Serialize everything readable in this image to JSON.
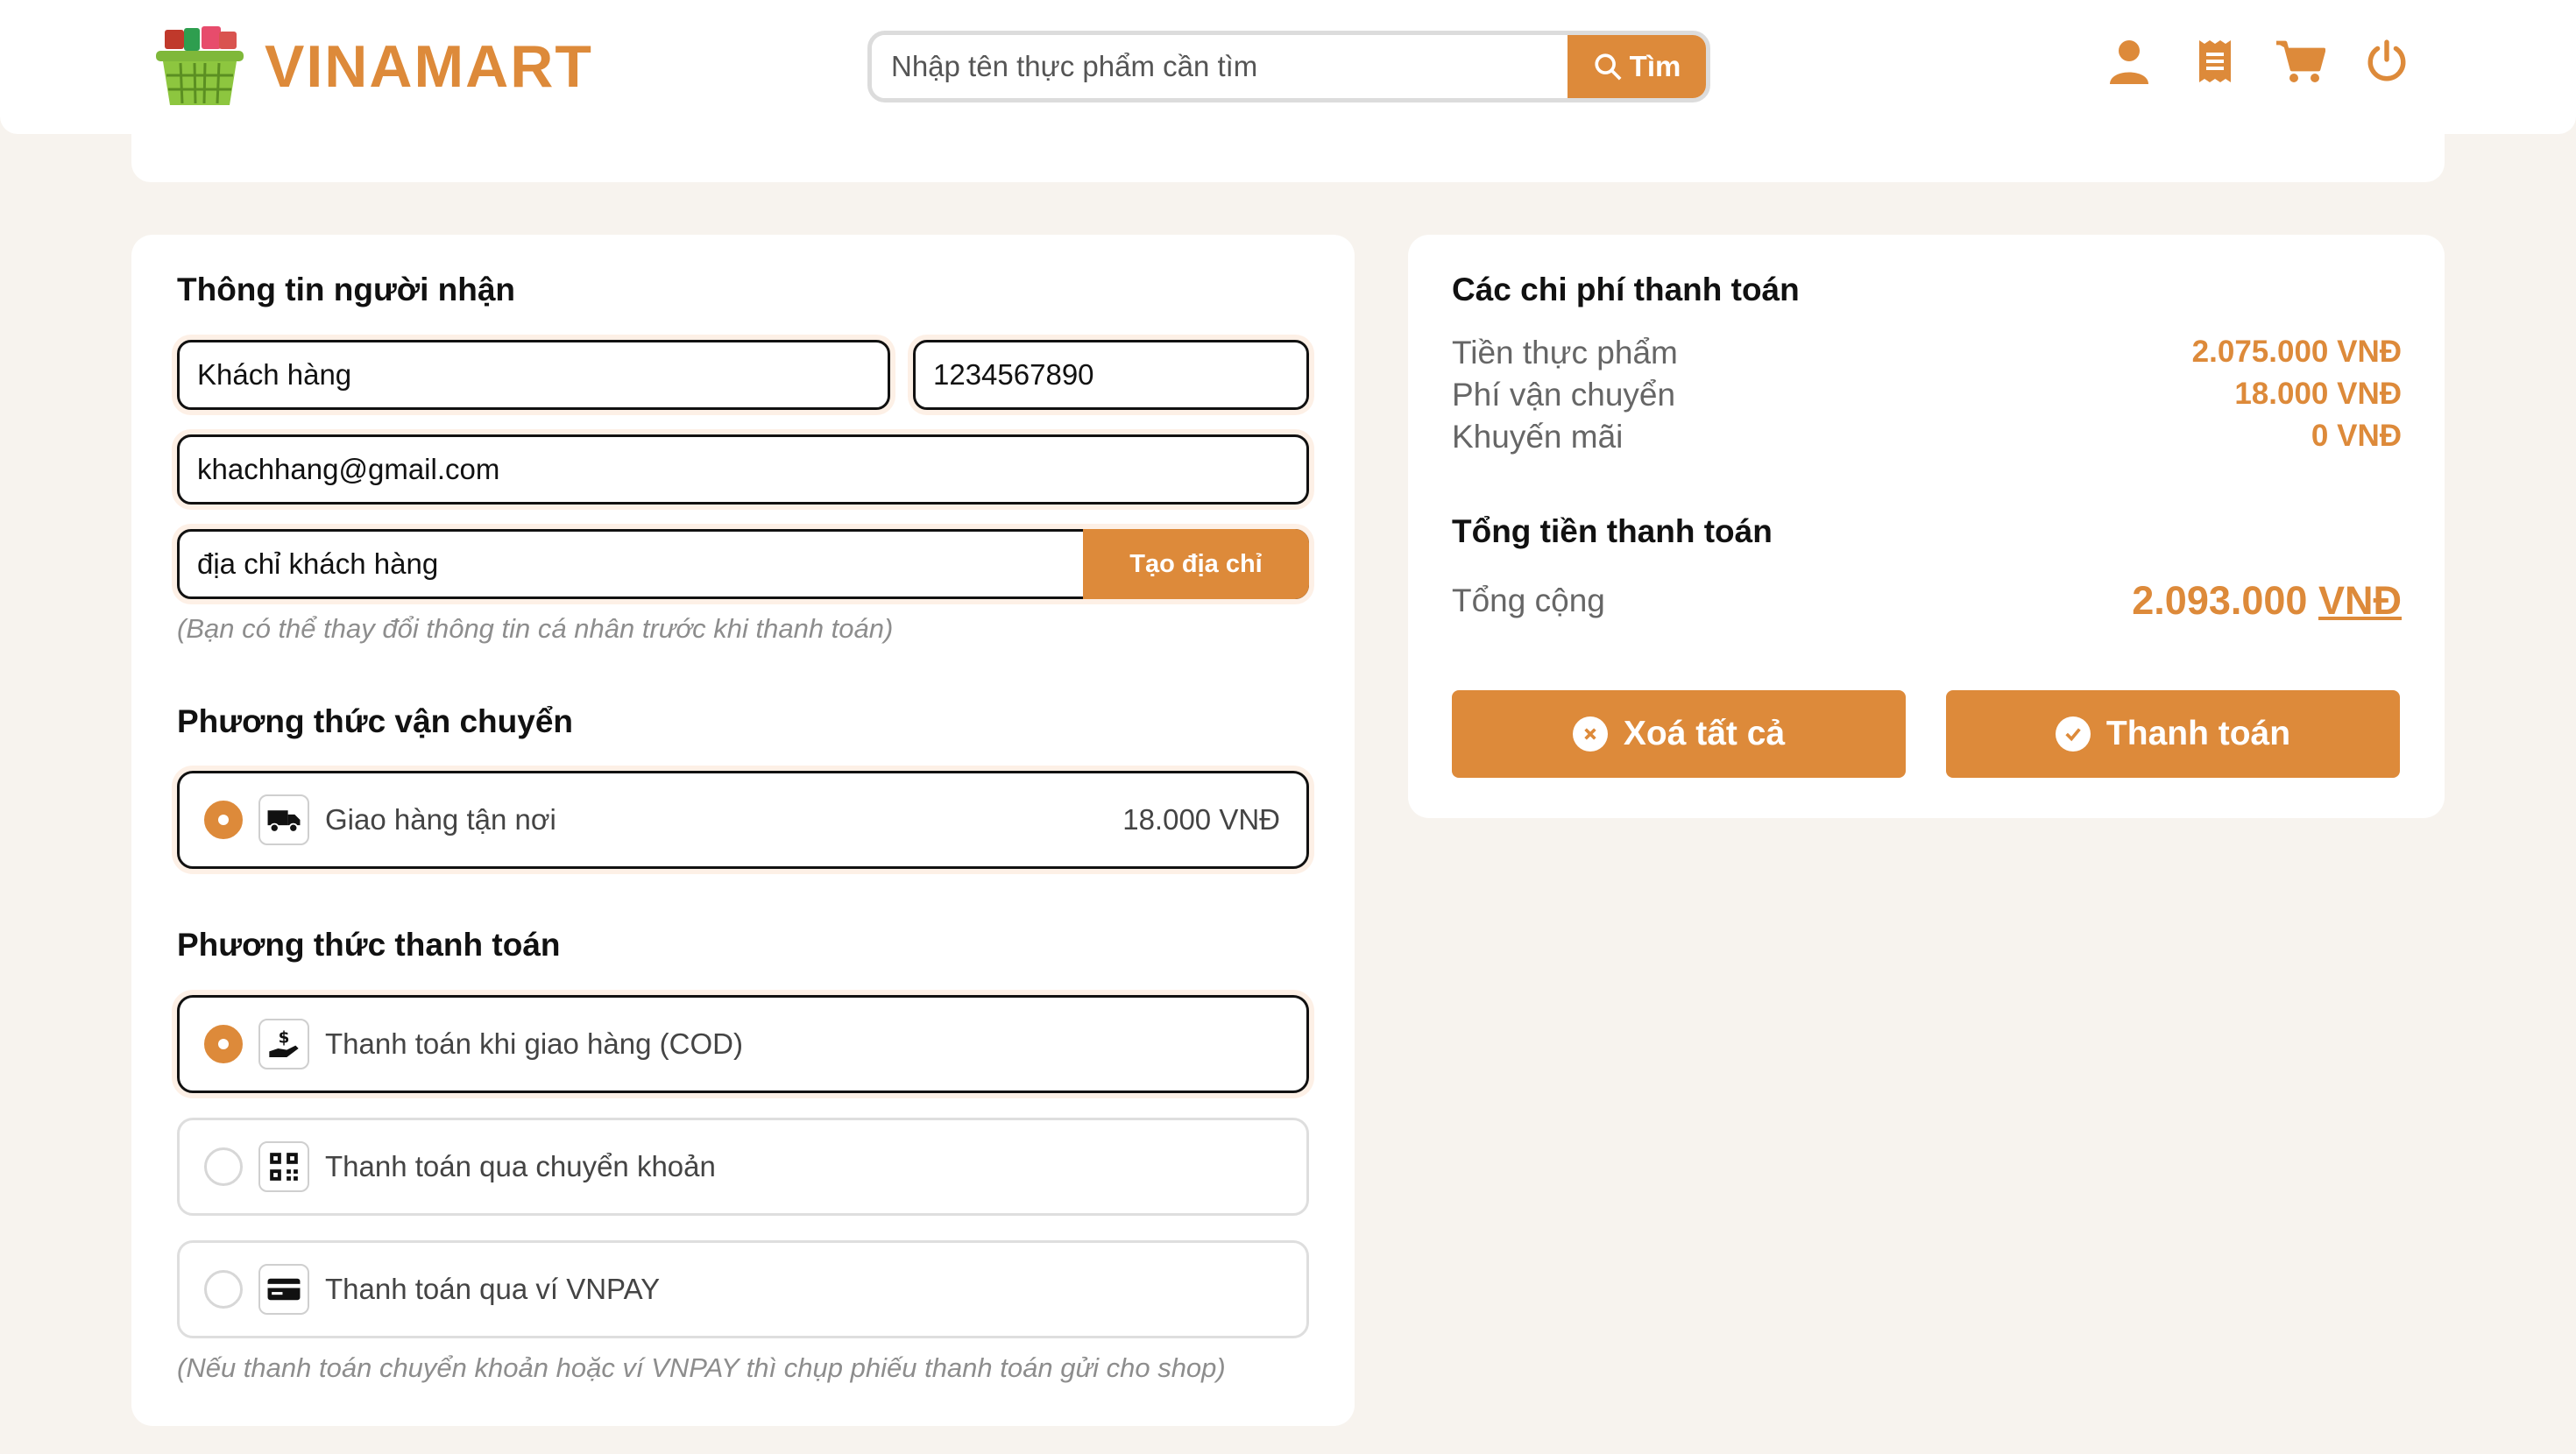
{
  "brand": {
    "name": "VINAMART"
  },
  "search": {
    "placeholder": "Nhập tên thực phẩm cần tìm",
    "button_label": "Tìm"
  },
  "header_icons": [
    "user-icon",
    "receipt-icon",
    "cart-icon",
    "power-icon"
  ],
  "recipient": {
    "title": "Thông tin người nhận",
    "name": "Khách hàng",
    "phone": "1234567890",
    "email": "khachhang@gmail.com",
    "address": "địa chỉ khách hàng",
    "create_address_label": "Tạo địa chỉ",
    "note": "(Bạn có thể thay đổi thông tin cá nhân trước khi thanh toán)"
  },
  "shipping": {
    "title": "Phương thức vận chuyển",
    "options": [
      {
        "label": "Giao hàng tận nơi",
        "price": "18.000 VNĐ",
        "selected": true,
        "icon": "truck-icon"
      }
    ]
  },
  "payment": {
    "title": "Phương thức thanh toán",
    "options": [
      {
        "label": "Thanh toán khi giao hàng (COD)",
        "selected": true,
        "icon": "cash-hand-icon"
      },
      {
        "label": "Thanh toán qua chuyển khoản",
        "selected": false,
        "icon": "qr-code-icon"
      },
      {
        "label": "Thanh toán qua ví VNPAY",
        "selected": false,
        "icon": "card-icon"
      }
    ],
    "note": "(Nếu thanh toán chuyển khoản hoặc ví VNPAY thì chụp phiếu thanh toán gửi cho shop)"
  },
  "costs": {
    "title": "Các chi phí thanh toán",
    "rows": [
      {
        "label": "Tiền thực phẩm",
        "value": "2.075.000 VNĐ"
      },
      {
        "label": "Phí vận chuyển",
        "value": "18.000 VNĐ"
      },
      {
        "label": "Khuyến mãi",
        "value": "0 VNĐ"
      }
    ],
    "total_title": "Tổng tiền thanh toán",
    "total_label": "Tổng cộng",
    "total_amount": "2.093.000",
    "total_currency": "VNĐ",
    "clear_label": "Xoá tất cả",
    "pay_label": "Thanh toán"
  },
  "colors": {
    "accent": "#dd8a3a",
    "background": "#f7f3ee"
  }
}
